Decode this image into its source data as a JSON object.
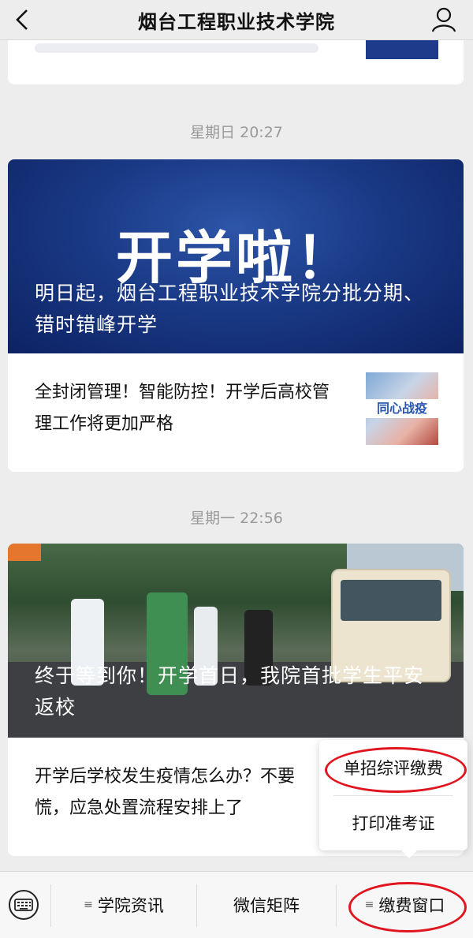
{
  "header": {
    "title": "烟台工程职业技术学院"
  },
  "feed": {
    "groups": [
      {
        "timestamp": "星期日 20:27",
        "hero_big_text": "开学啦！",
        "hero_caption": "明日起，烟台工程职业技术学院分批分期、错时错峰开学",
        "sub_article": "全封闭管理！智能防控！开学后高校管理工作将更加严格",
        "sub_thumb_text": "同心战疫"
      },
      {
        "timestamp": "星期一 22:56",
        "hero_caption": "终于等到你！开学首日，我院首批学生平安返校",
        "sub_article": "开学后学校发生疫情怎么办？不要慌，应急处置流程安排上了"
      }
    ]
  },
  "popup_menu": {
    "items": [
      "单招综评缴费",
      "打印准考证"
    ]
  },
  "bottom_menu": {
    "tabs": [
      {
        "label": "学院资讯",
        "glyph": "≡"
      },
      {
        "label": "微信矩阵",
        "glyph": ""
      },
      {
        "label": "缴费窗口",
        "glyph": "≡"
      }
    ]
  },
  "annotation_color": "#e0151f"
}
